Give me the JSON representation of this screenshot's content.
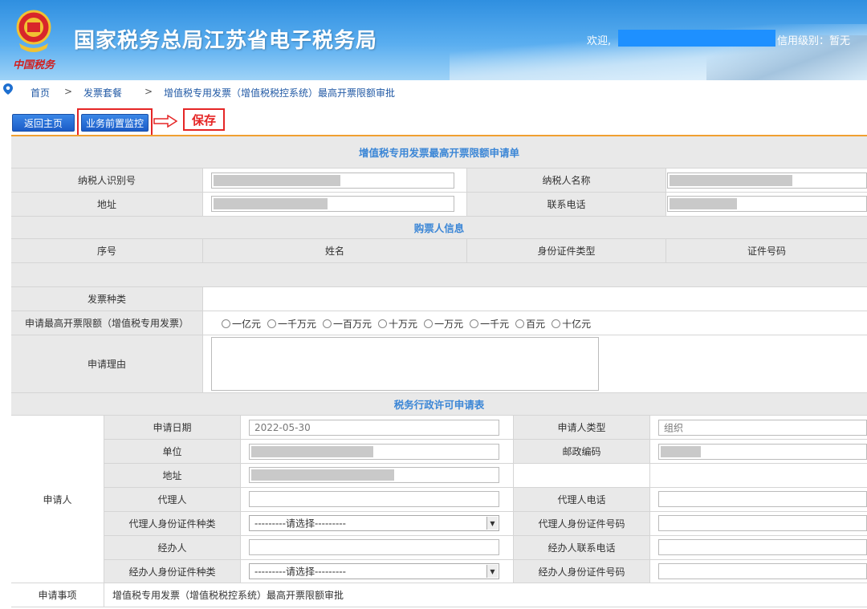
{
  "header": {
    "logo_text": "中国税务",
    "title": "国家税务总局江苏省电子税务局",
    "welcome": "欢迎,",
    "credit_level": "信用级别：暂无"
  },
  "breadcrumb": {
    "items": [
      "首页",
      "发票套餐",
      "增值税专用发票（增值税税控系统）最高开票限额审批"
    ],
    "separator": ">"
  },
  "toolbar": {
    "home_label": "返回主页",
    "monitor_label": "业务前置监控",
    "save_label": "保存"
  },
  "form": {
    "title": "增值税专用发票最高开票限额申请单",
    "taxpayer_id_label": "纳税人识别号",
    "taxpayer_name_label": "纳税人名称",
    "address_label": "地址",
    "phone_label": "联系电话",
    "buyer_section": "购票人信息",
    "buyer_cols": [
      "序号",
      "姓名",
      "身份证件类型",
      "证件号码"
    ],
    "invoice_type_label": "发票种类",
    "limit_label": "申请最高开票限额（增值税专用发票）",
    "limit_options": [
      "一亿元",
      "一千万元",
      "一百万元",
      "十万元",
      "一万元",
      "一千元",
      "百元",
      "十亿元"
    ],
    "reason_label": "申请理由",
    "permit_section": "税务行政许可申请表",
    "applicant_label": "申请人",
    "apply_date_label": "申请日期",
    "apply_date_value": "2022-05-30",
    "applicant_type_label": "申请人类型",
    "applicant_type_value": "组织",
    "unit_label": "单位",
    "postcode_label": "邮政编码",
    "addr2_label": "地址",
    "agent_label": "代理人",
    "agent_phone_label": "代理人电话",
    "agent_id_type_label": "代理人身份证件种类",
    "agent_id_no_label": "代理人身份证件号码",
    "handler_label": "经办人",
    "handler_phone_label": "经办人联系电话",
    "handler_id_type_label": "经办人身份证件种类",
    "handler_id_no_label": "经办人身份证件号码",
    "select_placeholder": "---------请选择---------",
    "matter_label": "申请事项",
    "matter_value": "增值税专用发票（增值税税控系统）最高开票限额审批"
  },
  "colors": {
    "accent": "#3b86d6",
    "highlight": "#e52626",
    "button": "#1b5cc8"
  }
}
